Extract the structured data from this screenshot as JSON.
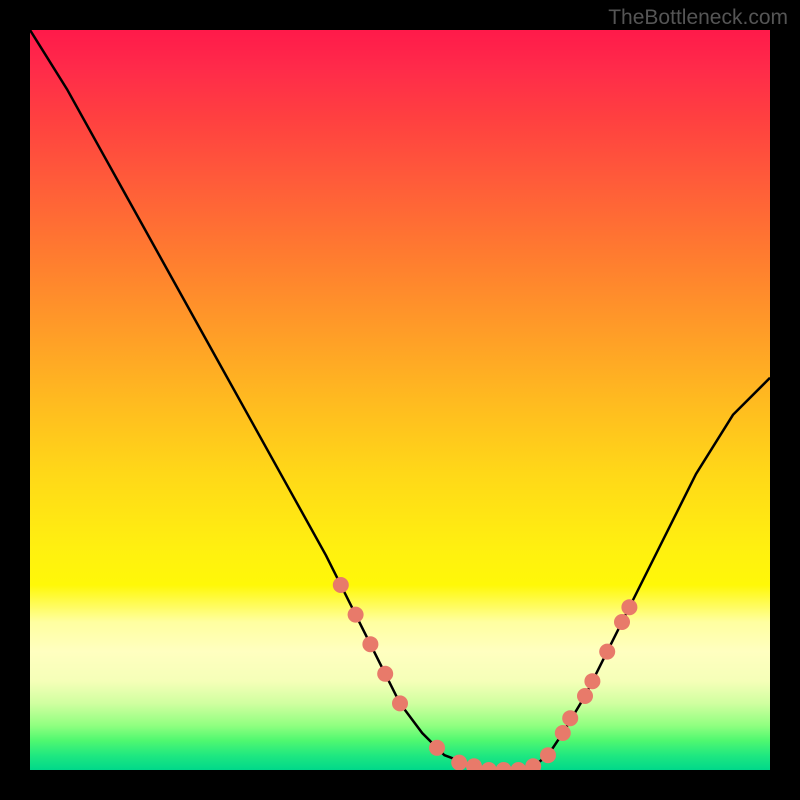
{
  "watermark": "TheBottleneck.com",
  "chart_data": {
    "type": "line",
    "title": "",
    "xlabel": "",
    "ylabel": "",
    "xlim": [
      0,
      100
    ],
    "ylim": [
      0,
      100
    ],
    "curve": {
      "name": "bottleneck-curve",
      "color": "#000000",
      "x": [
        0,
        5,
        10,
        15,
        20,
        25,
        30,
        35,
        40,
        42,
        45,
        48,
        50,
        53,
        56,
        60,
        63,
        66,
        68,
        70,
        72,
        75,
        80,
        85,
        90,
        95,
        100
      ],
      "y": [
        100,
        92,
        83,
        74,
        65,
        56,
        47,
        38,
        29,
        25,
        19,
        13,
        9,
        5,
        2,
        0.5,
        0,
        0,
        0.5,
        2,
        5,
        10,
        20,
        30,
        40,
        48,
        53
      ]
    },
    "markers": {
      "name": "highlight-points",
      "color": "#e87a6a",
      "radius": 8,
      "x": [
        42,
        44,
        46,
        48,
        50,
        55,
        58,
        60,
        62,
        64,
        66,
        68,
        70,
        72,
        73,
        75,
        76,
        78,
        80,
        81
      ],
      "y": [
        25,
        21,
        17,
        13,
        9,
        3,
        1,
        0.5,
        0,
        0,
        0,
        0.5,
        2,
        5,
        7,
        10,
        12,
        16,
        20,
        22
      ]
    },
    "gradient": {
      "stops": [
        {
          "offset": 0,
          "color": "#ff1a4a"
        },
        {
          "offset": 50,
          "color": "#ffd818"
        },
        {
          "offset": 100,
          "color": "#00d88a"
        }
      ]
    }
  }
}
